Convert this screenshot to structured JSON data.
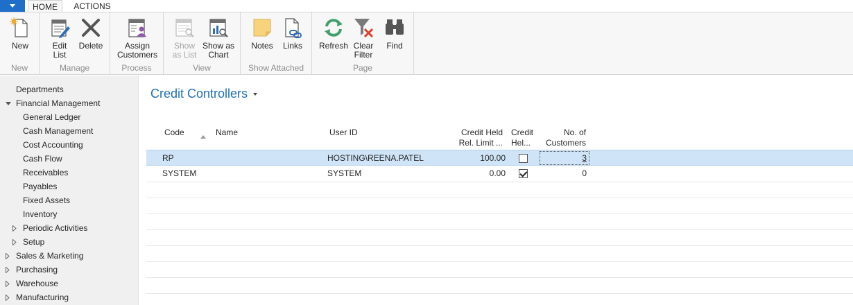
{
  "tabs": {
    "home": "HOME",
    "actions": "ACTIONS"
  },
  "ribbon": {
    "groups": {
      "new": "New",
      "manage": "Manage",
      "process": "Process",
      "view": "View",
      "show_attached": "Show Attached",
      "page": "Page"
    },
    "buttons": {
      "new": "New",
      "edit_list_1": "Edit",
      "edit_list_2": "List",
      "delete": "Delete",
      "assign_customers_1": "Assign",
      "assign_customers_2": "Customers",
      "show_as_list_1": "Show",
      "show_as_list_2": "as List",
      "show_as_chart_1": "Show as",
      "show_as_chart_2": "Chart",
      "notes": "Notes",
      "links": "Links",
      "refresh": "Refresh",
      "clear_filter_1": "Clear",
      "clear_filter_2": "Filter",
      "find": "Find"
    }
  },
  "nav": {
    "items": [
      {
        "label": "Departments"
      },
      {
        "label": "Financial Management"
      },
      {
        "label": "General Ledger"
      },
      {
        "label": "Cash Management"
      },
      {
        "label": "Cost Accounting"
      },
      {
        "label": "Cash Flow"
      },
      {
        "label": "Receivables"
      },
      {
        "label": "Payables"
      },
      {
        "label": "Fixed Assets"
      },
      {
        "label": "Inventory"
      },
      {
        "label": "Periodic Activities"
      },
      {
        "label": "Setup"
      },
      {
        "label": "Sales & Marketing"
      },
      {
        "label": "Purchasing"
      },
      {
        "label": "Warehouse"
      },
      {
        "label": "Manufacturing"
      }
    ]
  },
  "page": {
    "title": "Credit Controllers"
  },
  "table": {
    "headers": {
      "code": "Code",
      "name": "Name",
      "user_id": "User ID",
      "credit_held_limit_1": "Credit Held",
      "credit_held_limit_2": "Rel. Limit ...",
      "credit_held_1": "Credit",
      "credit_held_2": "Hel...",
      "no_customers_1": "No. of",
      "no_customers_2": "Customers"
    },
    "rows": [
      {
        "code": "RP",
        "name": "",
        "user_id": "HOSTING\\REENA.PATEL",
        "limit": "100.00",
        "held": false,
        "customers": "3"
      },
      {
        "code": "SYSTEM",
        "name": "",
        "user_id": "SYSTEM",
        "limit": "0.00",
        "held": true,
        "customers": "0"
      }
    ]
  },
  "colors": {
    "accent": "#1e6fb8",
    "app_button": "#1f6ec9",
    "selected_row": "#cfe4f7"
  },
  "icons": {
    "new": "new-document-icon",
    "edit_list": "edit-list-icon",
    "delete": "delete-x-icon",
    "assign": "assign-customers-icon",
    "show_list": "show-list-icon",
    "show_chart": "show-chart-icon",
    "notes": "notes-icon",
    "links": "links-icon",
    "refresh": "refresh-icon",
    "clear_filter": "clear-filter-icon",
    "find": "binoculars-icon"
  }
}
